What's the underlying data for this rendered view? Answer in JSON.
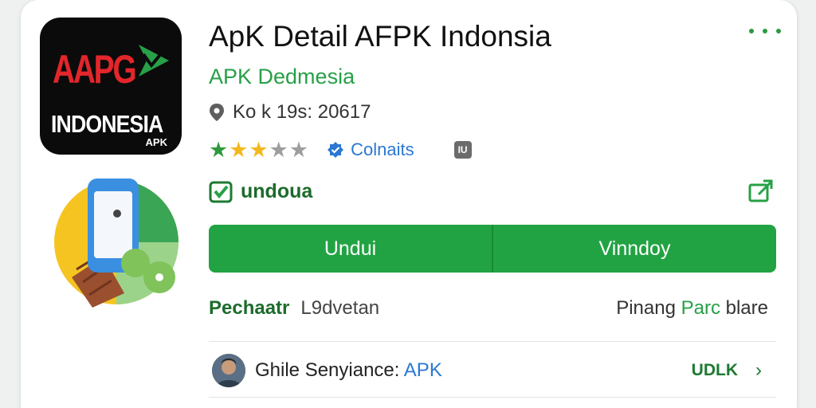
{
  "app": {
    "title": "ApK Detail AFPK Indonsia",
    "developer": "APK Dedmesia",
    "meta": "Ko k 19s: 20617",
    "rating_stars": 2.5,
    "rating_max": 5,
    "verified_label": "Colnaits",
    "badge_label": "IU",
    "download_status": "undoua"
  },
  "logo": {
    "brand_red": "AAPG",
    "word": "INDONESIA",
    "sub": "APK"
  },
  "buttons": {
    "primary": "Undui",
    "secondary": "Vinndoy"
  },
  "info": {
    "label": "Pechaatr",
    "value": "L9dvetan",
    "right_prefix": "Pinang",
    "right_green": "Parc",
    "right_suffix": "blare"
  },
  "comment": {
    "author_text": "Ghile Senyiance:",
    "link": "APK",
    "action": "UDLK",
    "chevron": "›"
  },
  "icons": {
    "more": "more-options-icon",
    "location": "location-pin-icon",
    "verified": "verified-check-icon",
    "download": "download-check-icon",
    "share": "share-icon"
  },
  "colors": {
    "accent_green": "#22a343",
    "dev_green": "#27a047",
    "link_blue": "#2a78d3",
    "logo_red": "#e3262b"
  }
}
